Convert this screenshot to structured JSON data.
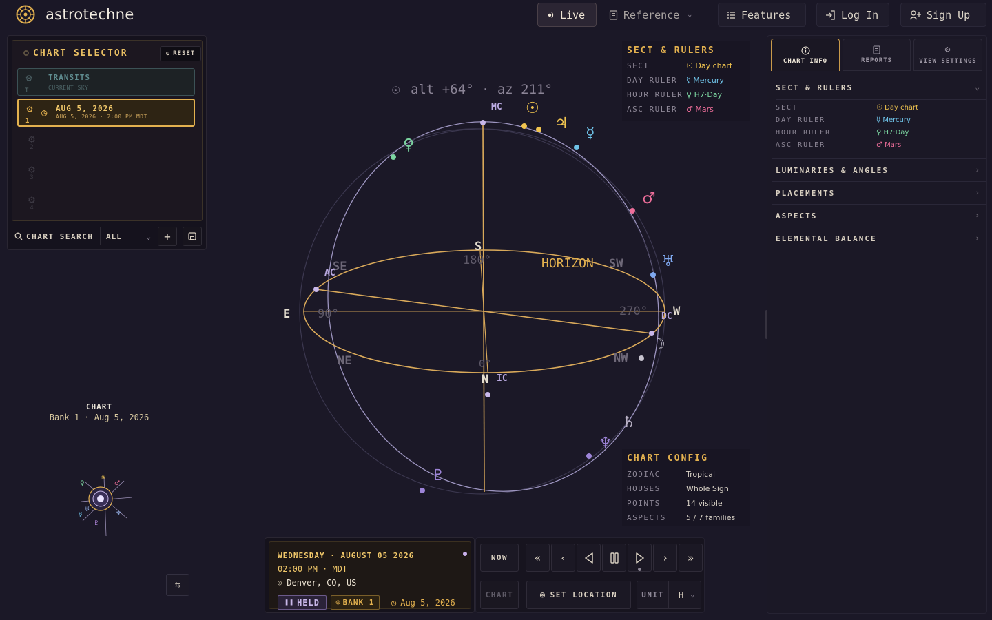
{
  "app": {
    "name": "astrotechne",
    "accent": "#e3b14f",
    "background": "#1b1827"
  },
  "nav": {
    "live_label": "Live",
    "reference_label": "Reference",
    "features_label": "Features",
    "login_label": "Log In",
    "signup_label": "Sign Up"
  },
  "selector": {
    "title": "CHART SELECTOR",
    "reset_label": "RESET",
    "transits": {
      "title": "TRANSITS",
      "subtitle": "CURRENT SKY",
      "slot": "T"
    },
    "active": {
      "slot": "1",
      "title": "AUG 5, 2026",
      "subtitle": "AUG 5, 2026 · 2:00 PM MDT"
    },
    "empty_slots": [
      "2",
      "3",
      "4"
    ],
    "search_label": "CHART SEARCH",
    "filter_value": "ALL"
  },
  "mini": {
    "caption_title": "CHART",
    "caption_sub": "Bank 1 · Aug 5, 2026"
  },
  "sphere": {
    "readout": "alt +64° · az 211°",
    "cardinals": {
      "north": "N",
      "south": "S",
      "east": "E",
      "west": "W"
    },
    "intercardinals": {
      "se": "SE",
      "sw": "SW",
      "ne": "NE",
      "nw": "NW"
    },
    "degrees": {
      "d0": "0°",
      "d90": "90°",
      "d180": "180°",
      "d270": "270°"
    },
    "horizon_label": "HORIZON",
    "angles": {
      "mc": "MC",
      "ic": "IC",
      "ac": "AC",
      "dc": "DC"
    },
    "colors": {
      "horizon": "#d9a95a",
      "meridian": "#d9a95a",
      "ecliptic": "#a9a0c8",
      "sun": "#f0c44f",
      "mercury": "#6fc3e8",
      "venus": "#7bd4a0",
      "mars": "#ee6e9a",
      "moon": "#c9b8ea",
      "jupiter": "#f0c44f"
    },
    "glyphs": {
      "sun": "☉",
      "moon": "☽",
      "mercury": "☿",
      "venus": "♀",
      "mars": "♂",
      "jupiter": "♃",
      "saturn": "♄",
      "uranus": "♅",
      "neptune": "♆",
      "pluto": "♇"
    }
  },
  "sect_overlay": {
    "title": "SECT & RULERS",
    "rows": [
      {
        "key": "SECT",
        "icon": "☉",
        "value": "Day chart",
        "color": "#f0c44f"
      },
      {
        "key": "DAY RULER",
        "icon": "☿",
        "value": "Mercury",
        "color": "#6fc3e8"
      },
      {
        "key": "HOUR RULER",
        "icon": "♀",
        "value": "H7·Day",
        "color": "#7bd4a0"
      },
      {
        "key": "ASC RULER",
        "icon": "♂",
        "value": "Mars",
        "color": "#ee6e9a"
      }
    ]
  },
  "config_overlay": {
    "title": "CHART CONFIG",
    "rows": [
      {
        "key": "ZODIAC",
        "value": "Tropical"
      },
      {
        "key": "HOUSES",
        "value": "Whole Sign"
      },
      {
        "key": "POINTS",
        "value": "14 visible"
      },
      {
        "key": "ASPECTS",
        "value": "5 / 7 families"
      }
    ]
  },
  "right_panel": {
    "tabs": [
      "CHART INFO",
      "REPORTS",
      "VIEW SETTINGS"
    ],
    "sect_title": "SECT & RULERS",
    "sect_rows": [
      {
        "key": "SECT",
        "icon": "☉",
        "value": "Day chart",
        "color": "#f0c44f"
      },
      {
        "key": "DAY RULER",
        "icon": "☿",
        "value": "Mercury",
        "color": "#6fc3e8"
      },
      {
        "key": "HOUR RULER",
        "icon": "♀",
        "value": "H7·Day",
        "color": "#7bd4a0"
      },
      {
        "key": "ASC RULER",
        "icon": "♂",
        "value": "Mars",
        "color": "#ee6e9a"
      }
    ],
    "sections": [
      "LUMINARIES & ANGLES",
      "PLACEMENTS",
      "ASPECTS",
      "ELEMENTAL BALANCE"
    ]
  },
  "datebox": {
    "date": "WEDNESDAY · AUGUST 05 2026",
    "time": "02:00 PM · MDT",
    "location": "Denver, CO, US",
    "held_label": "HELD",
    "bank_label": "BANK 1",
    "asof": "Aug 5, 2026"
  },
  "transport": {
    "now_label": "NOW",
    "chart_label": "CHART",
    "set_location_label": "SET LOCATION",
    "unit_label": "UNIT",
    "unit_value": "H"
  }
}
